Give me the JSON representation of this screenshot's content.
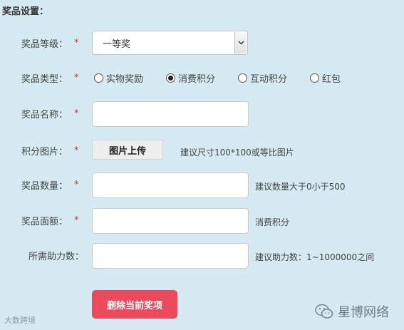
{
  "section_title": "奖品设置：",
  "required_mark": "*",
  "fields": {
    "level": {
      "label": "奖品等级：",
      "value": "一等奖"
    },
    "type": {
      "label": "奖品类型：",
      "options": [
        "实物奖励",
        "消费积分",
        "互动积分",
        "红包"
      ],
      "selected": "消费积分"
    },
    "name": {
      "label": "奖品名称：",
      "value": ""
    },
    "image": {
      "label": "积分图片：",
      "button": "图片上传",
      "hint": "建议尺寸100*100或等比图片"
    },
    "quantity": {
      "label": "奖品数量：",
      "value": "",
      "hint": "建议数量大于0小于500"
    },
    "amount": {
      "label": "奖品面额：",
      "value": "",
      "hint": "消费积分"
    },
    "assist": {
      "label": "所需助力数：",
      "value": "",
      "hint": "建议助力数：1~1000000之间"
    }
  },
  "delete_button": "删除当前奖项",
  "watermark_left": "大数跨境",
  "watermark_right": "星博网络",
  "icons": {
    "select_arrow": "chevron-down-icon",
    "wechat": "wechat-icon"
  }
}
